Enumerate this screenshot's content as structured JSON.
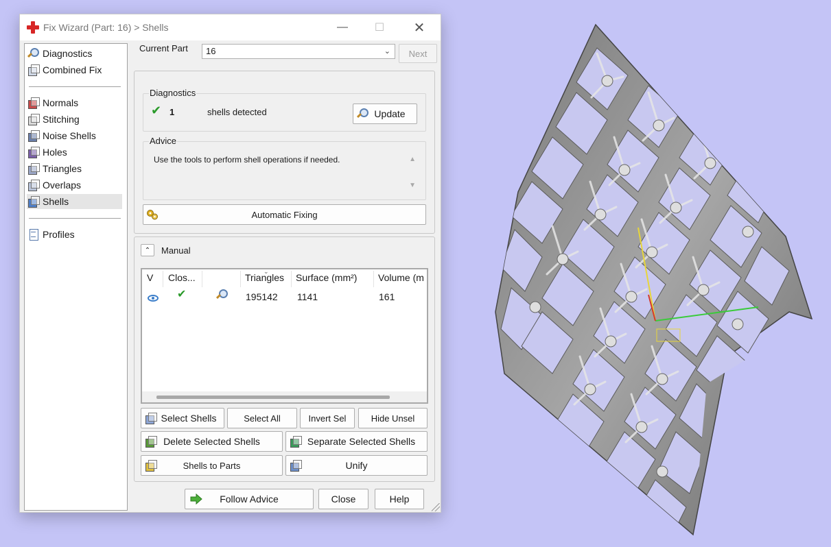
{
  "window": {
    "title": "Fix Wizard (Part: 16) > Shells",
    "controls": {
      "minimize": "—",
      "maximize": "☐",
      "close": "✕"
    }
  },
  "sidebar": {
    "items": [
      {
        "label": "Diagnostics",
        "icon": "magnifier-icon"
      },
      {
        "label": "Combined Fix",
        "icon": "cube-icon"
      },
      {
        "label": "Normals",
        "icon": "normals-cube-icon"
      },
      {
        "label": "Stitching",
        "icon": "stitching-cube-icon"
      },
      {
        "label": "Noise Shells",
        "icon": "noise-shells-cube-icon"
      },
      {
        "label": "Holes",
        "icon": "holes-cube-icon"
      },
      {
        "label": "Triangles",
        "icon": "triangles-cube-icon"
      },
      {
        "label": "Overlaps",
        "icon": "overlaps-cube-icon"
      },
      {
        "label": "Shells",
        "icon": "shells-cube-icon",
        "selected": true
      },
      {
        "label": "Profiles",
        "icon": "document-icon"
      }
    ]
  },
  "current_part": {
    "label": "Current Part",
    "value": "16",
    "next_label": "Next"
  },
  "diagnostics": {
    "title": "Diagnostics",
    "count": "1",
    "status_text": "shells detected",
    "update_label": "Update"
  },
  "advice": {
    "title": "Advice",
    "text": "Use the tools to perform shell operations if needed."
  },
  "automatic_fixing_label": "Automatic Fixing",
  "manual": {
    "title": "Manual",
    "table": {
      "columns": [
        "V",
        "Clos...",
        "",
        "Triangles",
        "Surface (mm²)",
        "Volume (m"
      ],
      "rows": [
        {
          "triangles": "195142",
          "surface": "1141",
          "volume": "161"
        }
      ]
    },
    "buttons": {
      "select_shells": "Select Shells",
      "select_all": "Select All",
      "invert_sel": "Invert Sel",
      "hide_unsel": "Hide Unsel",
      "delete_selected_shells": "Delete Selected Shells",
      "separate_selected_shells": "Separate Selected Shells",
      "shells_to_parts": "Shells to Parts",
      "unify": "Unify"
    }
  },
  "footer": {
    "follow_advice": "Follow Advice",
    "close": "Close",
    "help": "Help"
  },
  "colors": {
    "desktop_bg": "#c4c4f6",
    "accent_check": "#2a9a2a",
    "lattice_gray": "#8c8c8c"
  }
}
